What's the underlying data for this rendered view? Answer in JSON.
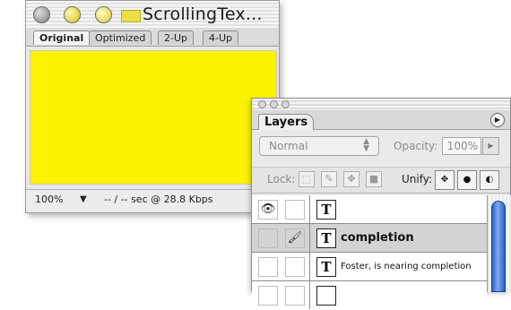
{
  "image_window": {
    "title": "ScrollingTex...",
    "tabs": [
      "Original",
      "Optimized",
      "2-Up",
      "4-Up"
    ],
    "active_tab": "Original",
    "canvas_color": "#fbf200",
    "status": {
      "zoom": "100%",
      "download_info": "-- / -- sec @ 28.8 Kbps"
    }
  },
  "layers_palette": {
    "tab_label": "Layers",
    "blend_mode": "Normal",
    "opacity_label": "Opacity:",
    "opacity_value": "100%",
    "lock_label": "Lock:",
    "unify_label": "Unify:",
    "layers": [
      {
        "name": "",
        "visible": true,
        "selected": false
      },
      {
        "name": "completion",
        "visible": false,
        "selected": true
      },
      {
        "name": "Foster, is nearing completion",
        "visible": false,
        "selected": false
      }
    ],
    "layer_thumb_glyph": "T"
  },
  "icons": {
    "zoom_arrow": "▼",
    "status_arrow": "▼",
    "palette_menu": "▶",
    "stepper": "▲▼",
    "opacity_arrow": "▶",
    "eye": "👁",
    "brush": "🖌"
  },
  "colors": {
    "canvas": "#fbf200",
    "scroll_thumb": "#3b6fd1",
    "selected_row": "#d3d3d3"
  }
}
